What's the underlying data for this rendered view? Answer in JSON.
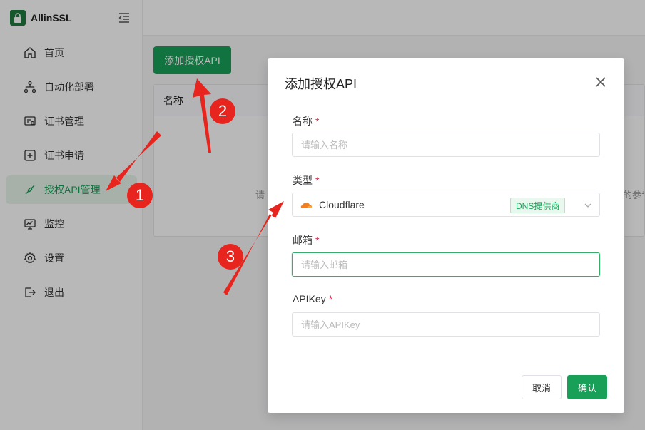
{
  "app": {
    "name": "AllinSSL",
    "logo_text": "AllinSSL"
  },
  "sidebar": {
    "items": [
      {
        "label": "首页",
        "icon": "home-icon"
      },
      {
        "label": "自动化部署",
        "icon": "workflow-icon"
      },
      {
        "label": "证书管理",
        "icon": "certificate-icon"
      },
      {
        "label": "证书申请",
        "icon": "plus-square-icon"
      },
      {
        "label": "授权API管理",
        "icon": "api-link-icon",
        "active": true
      },
      {
        "label": "监控",
        "icon": "monitor-icon"
      },
      {
        "label": "设置",
        "icon": "gear-icon"
      },
      {
        "label": "退出",
        "icon": "logout-icon"
      }
    ]
  },
  "main": {
    "add_button": "添加授权API",
    "table": {
      "column_name": "名称",
      "empty_text_left": "请",
      "empty_text_right": "的参专"
    }
  },
  "modal": {
    "title": "添加授权API",
    "required_mark": "*",
    "fields": {
      "name": {
        "label": "名称",
        "placeholder": "请输入名称"
      },
      "type": {
        "label": "类型",
        "value": "Cloudflare",
        "tag": "DNS提供商"
      },
      "email": {
        "label": "邮箱",
        "placeholder": "请输入邮箱"
      },
      "apikey": {
        "label": "APIKey",
        "placeholder": "请输入APIKey"
      }
    },
    "cancel": "取消",
    "confirm": "确认"
  },
  "annotations": [
    {
      "number": "1"
    },
    {
      "number": "2"
    },
    {
      "number": "3"
    }
  ],
  "colors": {
    "primary": "#18a058",
    "danger": "#d03050",
    "annotation": "#e7241d",
    "cloudflare": "#f38020"
  }
}
